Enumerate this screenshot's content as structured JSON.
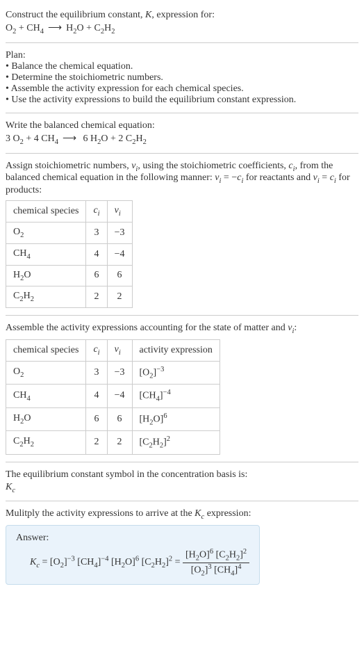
{
  "intro": {
    "line1": "Construct the equilibrium constant, ",
    "K": "K",
    "line1b": ", expression for:",
    "reactant1": "O",
    "reactant1_sub": "2",
    "plus": " + ",
    "reactant2": "CH",
    "reactant2_sub": "4",
    "arrow": "⟶",
    "product1": "H",
    "product1_sub": "2",
    "product1b": "O",
    "plus2": " + ",
    "product2": "C",
    "product2_sub": "2",
    "product2b": "H",
    "product2b_sub": "2"
  },
  "plan": {
    "heading": "Plan:",
    "b1": "• Balance the chemical equation.",
    "b2": "• Determine the stoichiometric numbers.",
    "b3": "• Assemble the activity expression for each chemical species.",
    "b4": "• Use the activity expressions to build the equilibrium constant expression."
  },
  "balance": {
    "intro": "Write the balanced chemical equation:",
    "c1": "3 O",
    "c1s": "2",
    "plus1": " + 4 CH",
    "c2s": "4",
    "arrow": "⟶",
    "p1": " 6 H",
    "p1s": "2",
    "p1b": "O + 2 C",
    "p2s": "2",
    "p2b": "H",
    "p2bs": "2"
  },
  "assign": {
    "text1": "Assign stoichiometric numbers, ",
    "nu": "ν",
    "i": "i",
    "text2": ", using the stoichiometric coefficients, ",
    "c": "c",
    "text3": ", from the balanced chemical equation in the following manner: ",
    "eq1a": "ν",
    "eq1b": " = −",
    "eq1c": "c",
    "text4": " for reactants and ",
    "eq2a": "ν",
    "eq2b": " = ",
    "eq2c": "c",
    "text5": " for products:"
  },
  "table1": {
    "h1": "chemical species",
    "h2": "c",
    "h2sub": "i",
    "h3": "ν",
    "h3sub": "i",
    "rows": [
      {
        "sp": "O",
        "spsub": "2",
        "c": "3",
        "nu": "−3"
      },
      {
        "sp": "CH",
        "spsub": "4",
        "c": "4",
        "nu": "−4"
      },
      {
        "sp": "H",
        "spsub": "2",
        "spb": "O",
        "c": "6",
        "nu": "6"
      },
      {
        "sp": "C",
        "spsub": "2",
        "spb": "H",
        "spbsub": "2",
        "c": "2",
        "nu": "2"
      }
    ]
  },
  "assemble": {
    "text": "Assemble the activity expressions accounting for the state of matter and ",
    "nu": "ν",
    "i": "i",
    "colon": ":"
  },
  "table2": {
    "h1": "chemical species",
    "h2": "c",
    "h2sub": "i",
    "h3": "ν",
    "h3sub": "i",
    "h4": "activity expression",
    "rows": [
      {
        "sp": "O",
        "spsub": "2",
        "c": "3",
        "nu": "−3",
        "act": "[O",
        "actsub": "2",
        "actb": "]",
        "actsup": "−3"
      },
      {
        "sp": "CH",
        "spsub": "4",
        "c": "4",
        "nu": "−4",
        "act": "[CH",
        "actsub": "4",
        "actb": "]",
        "actsup": "−4"
      },
      {
        "sp": "H",
        "spsub": "2",
        "spb": "O",
        "c": "6",
        "nu": "6",
        "act": "[H",
        "actsub": "2",
        "actb": "O]",
        "actsup": "6"
      },
      {
        "sp": "C",
        "spsub": "2",
        "spb": "H",
        "spbsub": "2",
        "c": "2",
        "nu": "2",
        "act": "[C",
        "actsub": "2",
        "actb": "H",
        "actbsub": "2",
        "actc": "]",
        "actsup": "2"
      }
    ]
  },
  "eqconst": {
    "text": "The equilibrium constant symbol in the concentration basis is:",
    "Kc": "K",
    "Kcsub": "c"
  },
  "multiply": {
    "text": "Mulitply the activity expressions to arrive at the ",
    "Kc": "K",
    "Kcsub": "c",
    "text2": " expression:"
  },
  "answer": {
    "label": "Answer:",
    "Kc": "K",
    "Kcsub": "c",
    "eq": " = [O",
    "o2sub": "2",
    "t1": "]",
    "exp1": "−3",
    "t2": " [CH",
    "ch4sub": "4",
    "t3": "]",
    "exp2": "−4",
    "t4": " [H",
    "h2sub": "2",
    "t5": "O]",
    "exp3": "6",
    "t6": " [C",
    "c2sub": "2",
    "t7": "H",
    "h2sub2": "2",
    "t8": "]",
    "exp4": "2",
    "eq2": " = ",
    "num1": "[H",
    "numsub1": "2",
    "num2": "O]",
    "numsup1": "6",
    "num3": " [C",
    "numsub2": "2",
    "num4": "H",
    "numsub3": "2",
    "num5": "]",
    "numsup2": "2",
    "den1": "[O",
    "densub1": "2",
    "den2": "]",
    "densup1": "3",
    "den3": " [CH",
    "densub2": "4",
    "den4": "]",
    "densup2": "4"
  }
}
